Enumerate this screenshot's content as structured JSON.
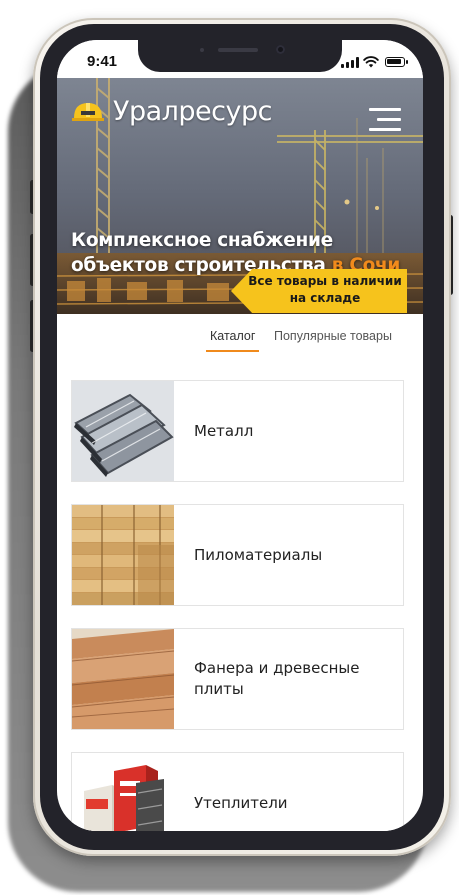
{
  "status_bar": {
    "time": "9:41"
  },
  "header": {
    "brand": "Уралресурс",
    "logo_icon": "hard-hat-icon",
    "menu_icon": "hamburger-menu-icon"
  },
  "hero": {
    "headline_line1": "Комплексное снабжение",
    "headline_line2": "объектов строительства",
    "headline_accent": "в Сочи",
    "badge_line1": "Все товары в наличии",
    "badge_line2": "на складе"
  },
  "tabs": [
    {
      "label": "Каталог",
      "active": true
    },
    {
      "label": "Популярные товары",
      "active": false
    }
  ],
  "catalog": [
    {
      "label": "Металл",
      "image": "metal-profiles-image"
    },
    {
      "label": "Пиломатериалы",
      "image": "lumber-stack-image"
    },
    {
      "label": "Фанера и древесные плиты",
      "image": "plywood-sheets-image"
    },
    {
      "label": "Утеплители",
      "image": "insulation-packs-image"
    }
  ],
  "colors": {
    "accent": "#f08a1c",
    "badge": "#f6c31c",
    "frame": "#efebe3",
    "bezel": "#23232a"
  }
}
